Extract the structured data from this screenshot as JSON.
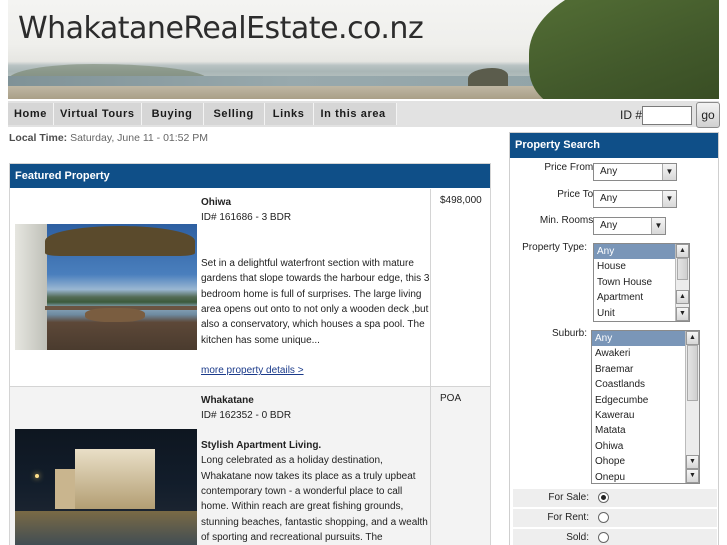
{
  "site": {
    "title": "WhakataneRealEstate.co.nz"
  },
  "nav": {
    "items": [
      "Home",
      "Virtual Tours",
      "Buying",
      "Selling",
      "Links",
      "In this area"
    ],
    "id_label": "ID #",
    "id_value": "",
    "go_label": "go"
  },
  "local_time": {
    "label": "Local Time:",
    "value": "Saturday, June 11 - 01:52 PM"
  },
  "featured": {
    "heading": "Featured Property",
    "listings": [
      {
        "name": "Ohiwa",
        "id_line": "ID# 161686 - 3 BDR",
        "price": "$498,000",
        "headline": "",
        "description": "Set in a delightful waterfront section with mature gardens that slope towards the harbour edge, this 3 bedroom home is full of surprises. The large living area opens out onto to not only a wooden deck ,but also a conservatory, which houses a spa pool. The kitchen has some unique...",
        "more_link": "more property details >"
      },
      {
        "name": "Whakatane",
        "id_line": "ID# 162352 - 0 BDR",
        "price": "POA",
        "headline": "Stylish Apartment Living.",
        "description": "Long celebrated as a holiday destination, Whakatane now takes its place as a truly upbeat contemporary town - a wonderful place to call home. Within reach are great fishing grounds, stunning beaches, fantastic shopping, and a wealth of sporting and recreational pursuits. The prestigious",
        "more_link": ""
      }
    ]
  },
  "search": {
    "heading": "Property Search",
    "price_from": {
      "label": "Price From:",
      "value": "Any"
    },
    "price_to": {
      "label": "Price To:",
      "value": "Any"
    },
    "min_rooms": {
      "label": "Min. Rooms:",
      "value": "Any"
    },
    "property_type": {
      "label": "Property Type:",
      "options": [
        "Any",
        "House",
        "Town House",
        "Apartment",
        "Unit"
      ],
      "selected": "Any"
    },
    "suburb": {
      "label": "Suburb:",
      "options": [
        "Any",
        "Awakeri",
        "Braemar",
        "Coastlands",
        "Edgecumbe",
        "Kawerau",
        "Matata",
        "Ohiwa",
        "Ohope",
        "Onepu"
      ],
      "selected": "Any"
    },
    "for_sale": {
      "label": "For Sale:",
      "checked": true
    },
    "for_rent": {
      "label": "For Rent:",
      "checked": false
    },
    "sold": {
      "label": "Sold:",
      "checked": false
    }
  }
}
